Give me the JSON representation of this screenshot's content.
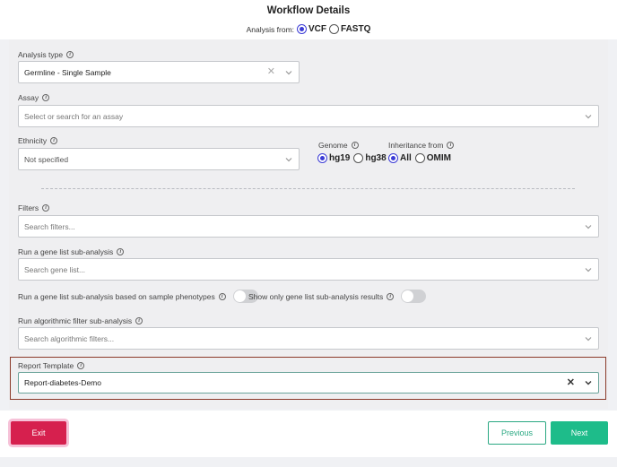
{
  "header": {
    "title": "Workflow Details",
    "analysis_from_label": "Analysis from:",
    "analysis_from_options": [
      "VCF",
      "FASTQ"
    ],
    "analysis_from_selected": "VCF"
  },
  "form": {
    "analysis_type": {
      "label": "Analysis type",
      "value": "Germline - Single Sample"
    },
    "assay": {
      "label": "Assay",
      "placeholder": "Select or search for an assay"
    },
    "ethnicity": {
      "label": "Ethnicity",
      "value": "Not specified"
    },
    "genome": {
      "label": "Genome",
      "options": [
        "hg19",
        "hg38"
      ],
      "selected": "hg19"
    },
    "inheritance": {
      "label": "Inheritance from",
      "options": [
        "All",
        "OMIM"
      ],
      "selected": "All"
    },
    "filters": {
      "label": "Filters",
      "placeholder": "Search filters..."
    },
    "gene_list": {
      "label": "Run a gene list sub-analysis",
      "placeholder": "Search gene list..."
    },
    "phenotype_toggle": {
      "label": "Run a gene list sub-analysis based on sample phenotypes",
      "on": false
    },
    "results_toggle": {
      "label": "Show only gene list sub-analysis results",
      "on": false
    },
    "algorithmic": {
      "label": "Run algorithmic filter sub-analysis",
      "placeholder": "Search algorithmic filters..."
    },
    "report_template": {
      "label": "Report Template",
      "value": "Report-diabetes-Demo"
    }
  },
  "footer": {
    "exit_label": "Exit",
    "previous_label": "Previous",
    "next_label": "Next"
  },
  "colors": {
    "accent_radio": "#3b3bd6",
    "exit": "#d6204e",
    "next": "#1ebc8a",
    "previous_border": "#2aa882",
    "highlight_border": "#8b3a2a"
  }
}
